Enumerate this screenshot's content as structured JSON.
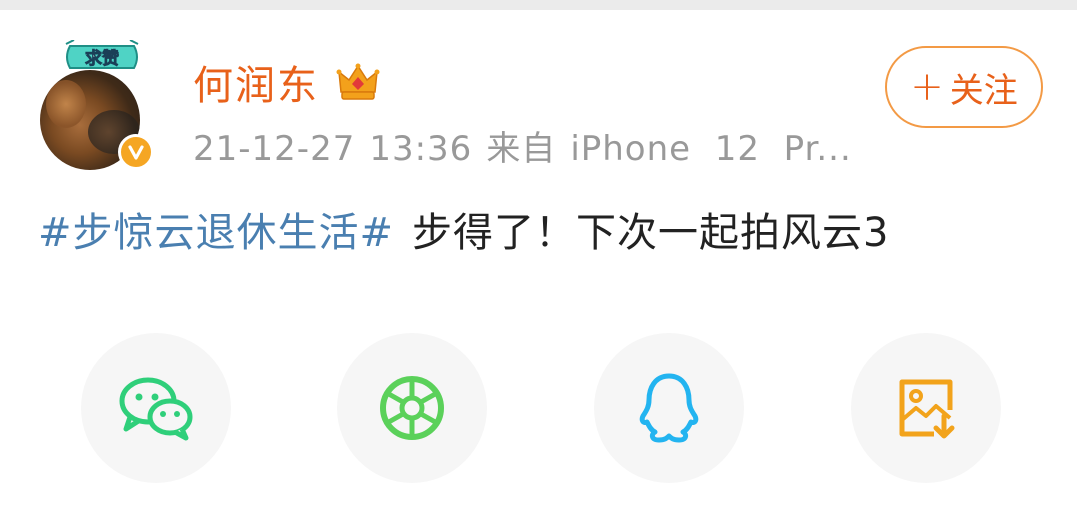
{
  "user": {
    "name": "何润东",
    "avatar_badge": "求赞"
  },
  "post": {
    "date": "21-12-27",
    "time": "13:36",
    "source_label": "来自",
    "device": "iPhone  12  Pr...",
    "hashtag": "#步惊云退休生活#",
    "text": "步得了！下次一起拍风云3"
  },
  "follow": {
    "label": "关注"
  },
  "share": {
    "items": [
      "wechat-icon",
      "moments-icon",
      "qq-icon",
      "save-image-icon"
    ]
  },
  "colors": {
    "username": "#e8611a",
    "hashtag": "#4a7fb0",
    "follow_border": "#f39a45",
    "wechat": "#2fcf7a",
    "moments": "#5bd15a",
    "qq": "#23b4f0",
    "save": "#f2a31b"
  }
}
